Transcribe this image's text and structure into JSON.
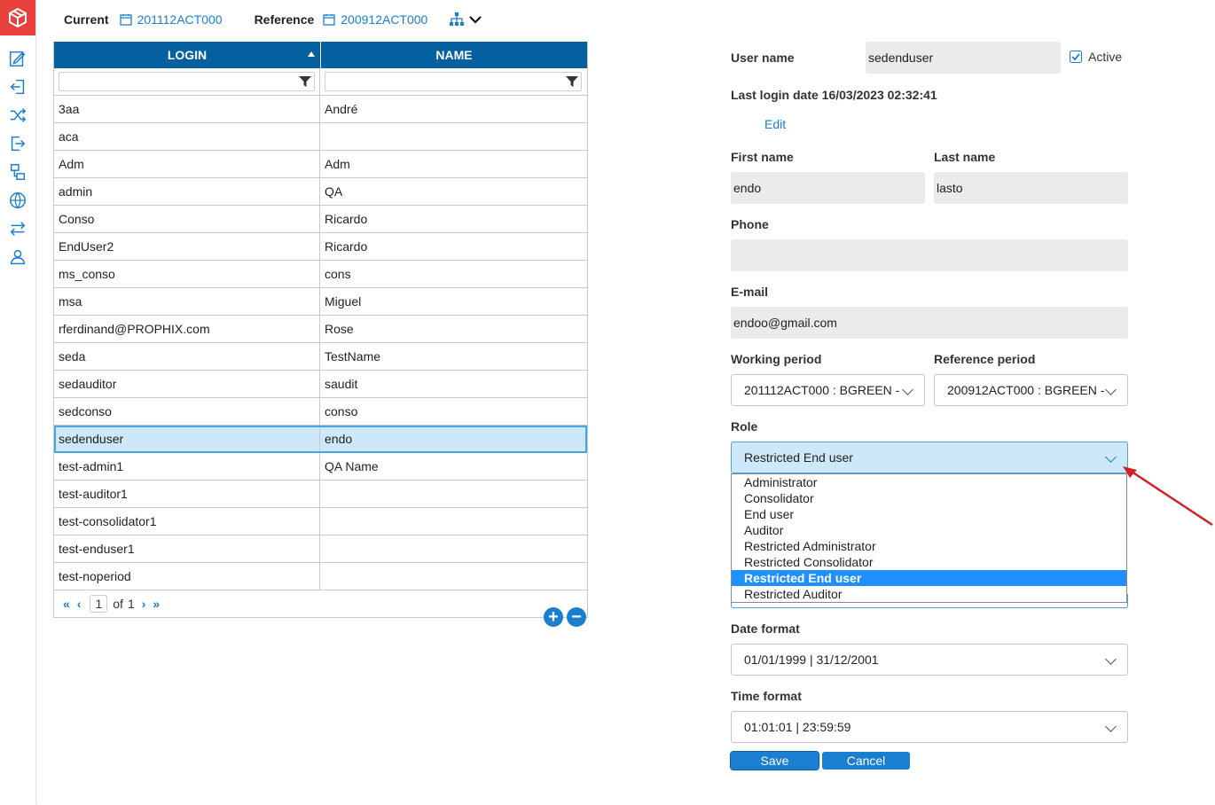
{
  "toolbar": {
    "current_label": "Current",
    "current_value": "201112ACT000",
    "reference_label": "Reference",
    "reference_value": "200912ACT000"
  },
  "sidebar": {
    "icons": [
      "cube-logo-icon",
      "edit-icon",
      "import-icon",
      "shuffle-icon",
      "export-icon",
      "hierarchy-icon",
      "globe-icon",
      "transfer-icon",
      "users-icon"
    ]
  },
  "grid": {
    "columns": [
      "LOGIN",
      "NAME"
    ],
    "rows": [
      {
        "login": "3aa",
        "name": "André"
      },
      {
        "login": "aca",
        "name": ""
      },
      {
        "login": "Adm",
        "name": "Adm"
      },
      {
        "login": "admin",
        "name": "QA"
      },
      {
        "login": "Conso",
        "name": "Ricardo"
      },
      {
        "login": "EndUser2",
        "name": "Ricardo"
      },
      {
        "login": "ms_conso",
        "name": "cons"
      },
      {
        "login": "msa",
        "name": "Miguel"
      },
      {
        "login": "rferdinand@PROPHIX.com",
        "name": "Rose"
      },
      {
        "login": "seda",
        "name": "TestName"
      },
      {
        "login": "sedauditor",
        "name": "saudit"
      },
      {
        "login": "sedconso",
        "name": "conso"
      },
      {
        "login": "sedenduser",
        "name": "endo"
      },
      {
        "login": "test-admin1",
        "name": "QA Name"
      },
      {
        "login": "test-auditor1",
        "name": ""
      },
      {
        "login": "test-consolidator1",
        "name": ""
      },
      {
        "login": "test-enduser1",
        "name": ""
      },
      {
        "login": "test-noperiod",
        "name": ""
      }
    ],
    "selected_index": 12,
    "pager": {
      "first": "«",
      "prev": "‹",
      "page": "1",
      "of": "of",
      "total": "1",
      "next": "›",
      "last": "»"
    }
  },
  "form": {
    "username_label": "User name",
    "username_value": "sedenduser",
    "active_label": "Active",
    "active_checked": true,
    "last_login": "Last login date 16/03/2023 02:32:41",
    "edit_link": "Edit",
    "firstname_label": "First name",
    "firstname_value": "endo",
    "lastname_label": "Last name",
    "lastname_value": "lasto",
    "phone_label": "Phone",
    "phone_value": "",
    "email_label": "E-mail",
    "email_value": "endoo@gmail.com",
    "working_label": "Working period",
    "working_value": "201112ACT000 : BGREEN -",
    "reference_label": "Reference period",
    "reference_value": "200912ACT000 : BGREEN -",
    "role_label": "Role",
    "role_value": "Restricted End user",
    "role_options": [
      "Administrator",
      "Consolidator",
      "End user",
      "Auditor",
      "Restricted Administrator",
      "Restricted Consolidator",
      "Restricted End user",
      "Restricted Auditor"
    ],
    "role_selected_index": 6,
    "dateformat_label": "Date format",
    "dateformat_value": "01/01/1999 | 31/12/2001",
    "timeformat_label": "Time format",
    "timeformat_value": "01:01:01 | 23:59:59",
    "save_label": "Save",
    "cancel_label": "Cancel"
  },
  "colors": {
    "accent": "#1a7fd0",
    "header": "#04609e",
    "logo": "#e8403a",
    "selected_row": "#cde9f9",
    "arrow": "#d0202a"
  }
}
